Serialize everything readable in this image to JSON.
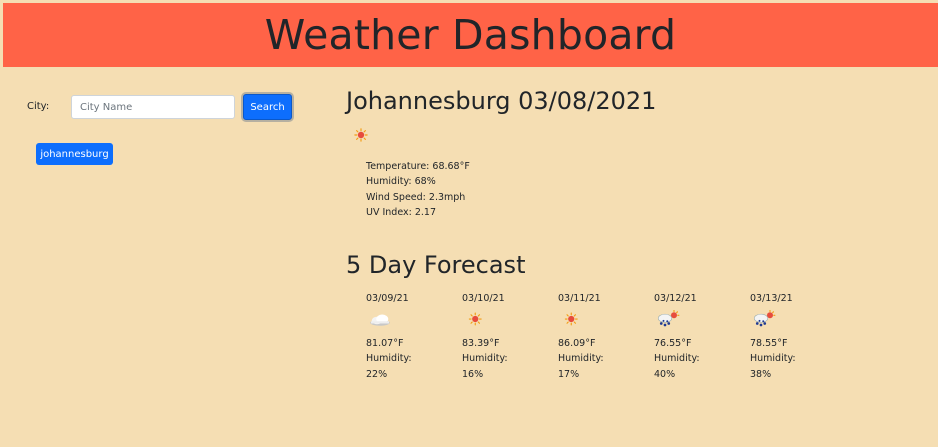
{
  "header": {
    "title": "Weather Dashboard"
  },
  "search": {
    "label": "City:",
    "placeholder": "City Name",
    "value": "",
    "button_label": "Search",
    "history": [
      "johannesburg"
    ]
  },
  "current": {
    "title": "Johannesburg 03/08/2021",
    "icon": "sun-icon",
    "temperature": "Temperature: 68.68°F",
    "humidity": "Humidity: 68%",
    "wind": "Wind Speed: 2.3mph",
    "uv": "UV Index: 2.17"
  },
  "forecast": {
    "title": "5 Day Forecast",
    "humidity_label": "Humidity:",
    "days": [
      {
        "date": "03/09/21",
        "icon": "cloud-icon",
        "temp": "81.07°F",
        "humidity": "22%"
      },
      {
        "date": "03/10/21",
        "icon": "sun-icon",
        "temp": "83.39°F",
        "humidity": "16%"
      },
      {
        "date": "03/11/21",
        "icon": "sun-icon",
        "temp": "86.09°F",
        "humidity": "17%"
      },
      {
        "date": "03/12/21",
        "icon": "rain-sun-icon",
        "temp": "76.55°F",
        "humidity": "40%"
      },
      {
        "date": "03/13/21",
        "icon": "rain-sun-icon",
        "temp": "78.55°F",
        "humidity": "38%"
      }
    ]
  },
  "colors": {
    "header_bg": "#ff6347",
    "page_bg": "#f5deb3",
    "button_bg": "#0d6efd"
  }
}
